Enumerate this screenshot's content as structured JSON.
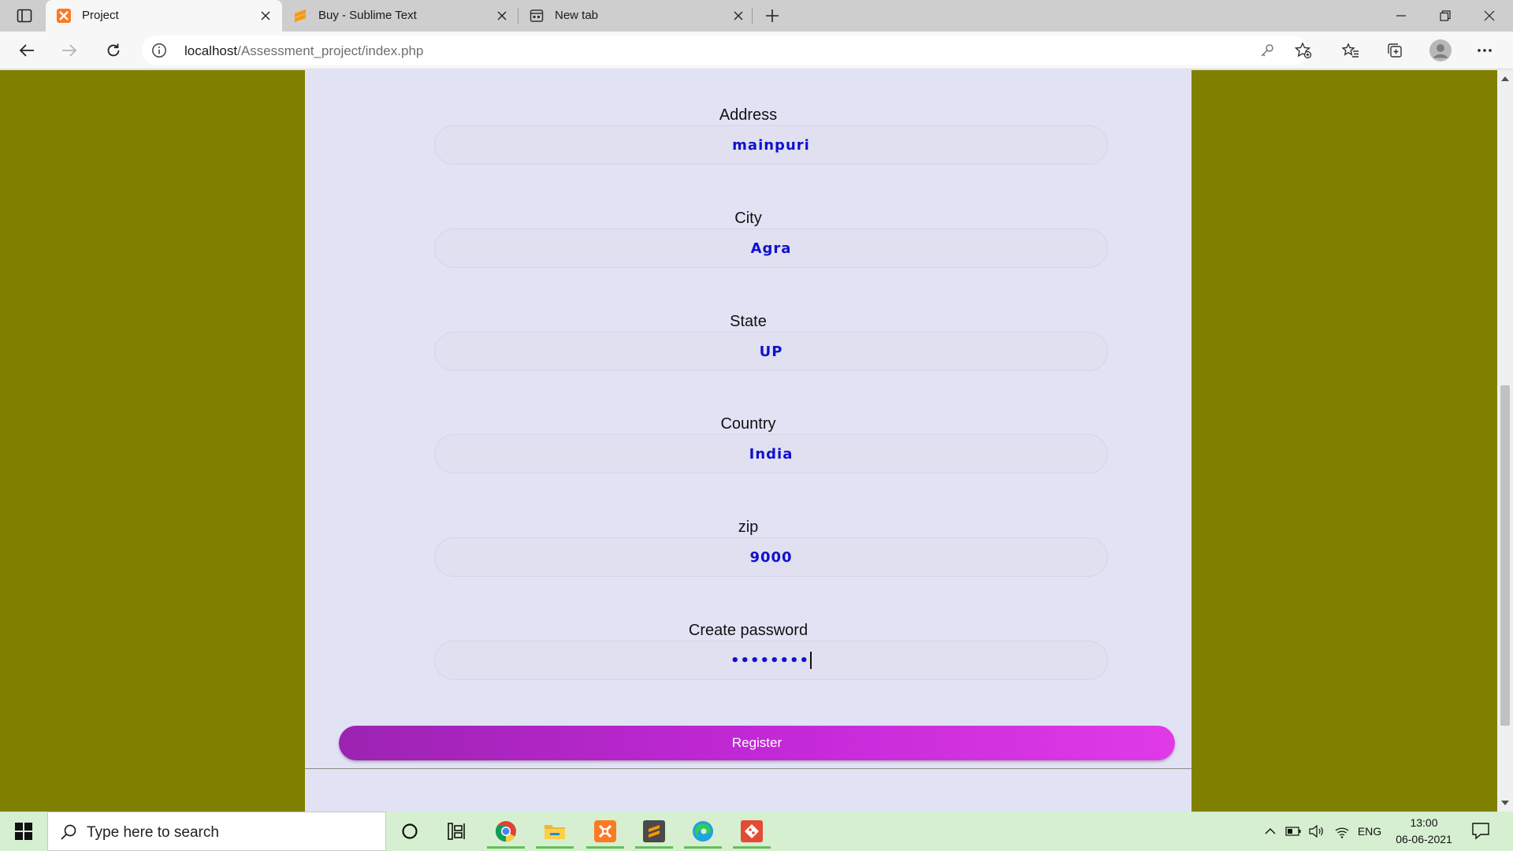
{
  "browser": {
    "tabs": [
      {
        "title": "Project",
        "favicon": "xampp-icon",
        "active": true
      },
      {
        "title": "Buy - Sublime Text",
        "favicon": "sublime-icon",
        "active": false
      },
      {
        "title": "New tab",
        "favicon": "new-tab-page-icon",
        "active": false
      }
    ],
    "address": {
      "host": "localhost",
      "path": "/Assessment_project/index.php"
    }
  },
  "form": {
    "fields": [
      {
        "label": "Address",
        "value": "mainpuri"
      },
      {
        "label": "City",
        "value": "Agra"
      },
      {
        "label": "State",
        "value": "UP"
      },
      {
        "label": "Country",
        "value": "India"
      },
      {
        "label": "zip",
        "value": "9000"
      },
      {
        "label": "Create password",
        "value": "••••••••"
      }
    ],
    "submit_label": "Register"
  },
  "colors": {
    "page_background": "#808000",
    "panel_background": "#e2e2f5",
    "input_text": "#1010d0",
    "button_gradient_start": "#9c23b2",
    "button_gradient_end": "#e03ae8",
    "taskbar": "#d6efd0"
  },
  "taskbar": {
    "search_placeholder": "Type here to search",
    "apps": [
      "cortana-icon",
      "task-view-icon",
      "chrome-icon",
      "file-explorer-icon",
      "xampp-icon",
      "sublime-text-icon",
      "edge-icon",
      "git-icon"
    ],
    "tray_language": "ENG",
    "time": "13:00",
    "date": "06-06-2021"
  }
}
